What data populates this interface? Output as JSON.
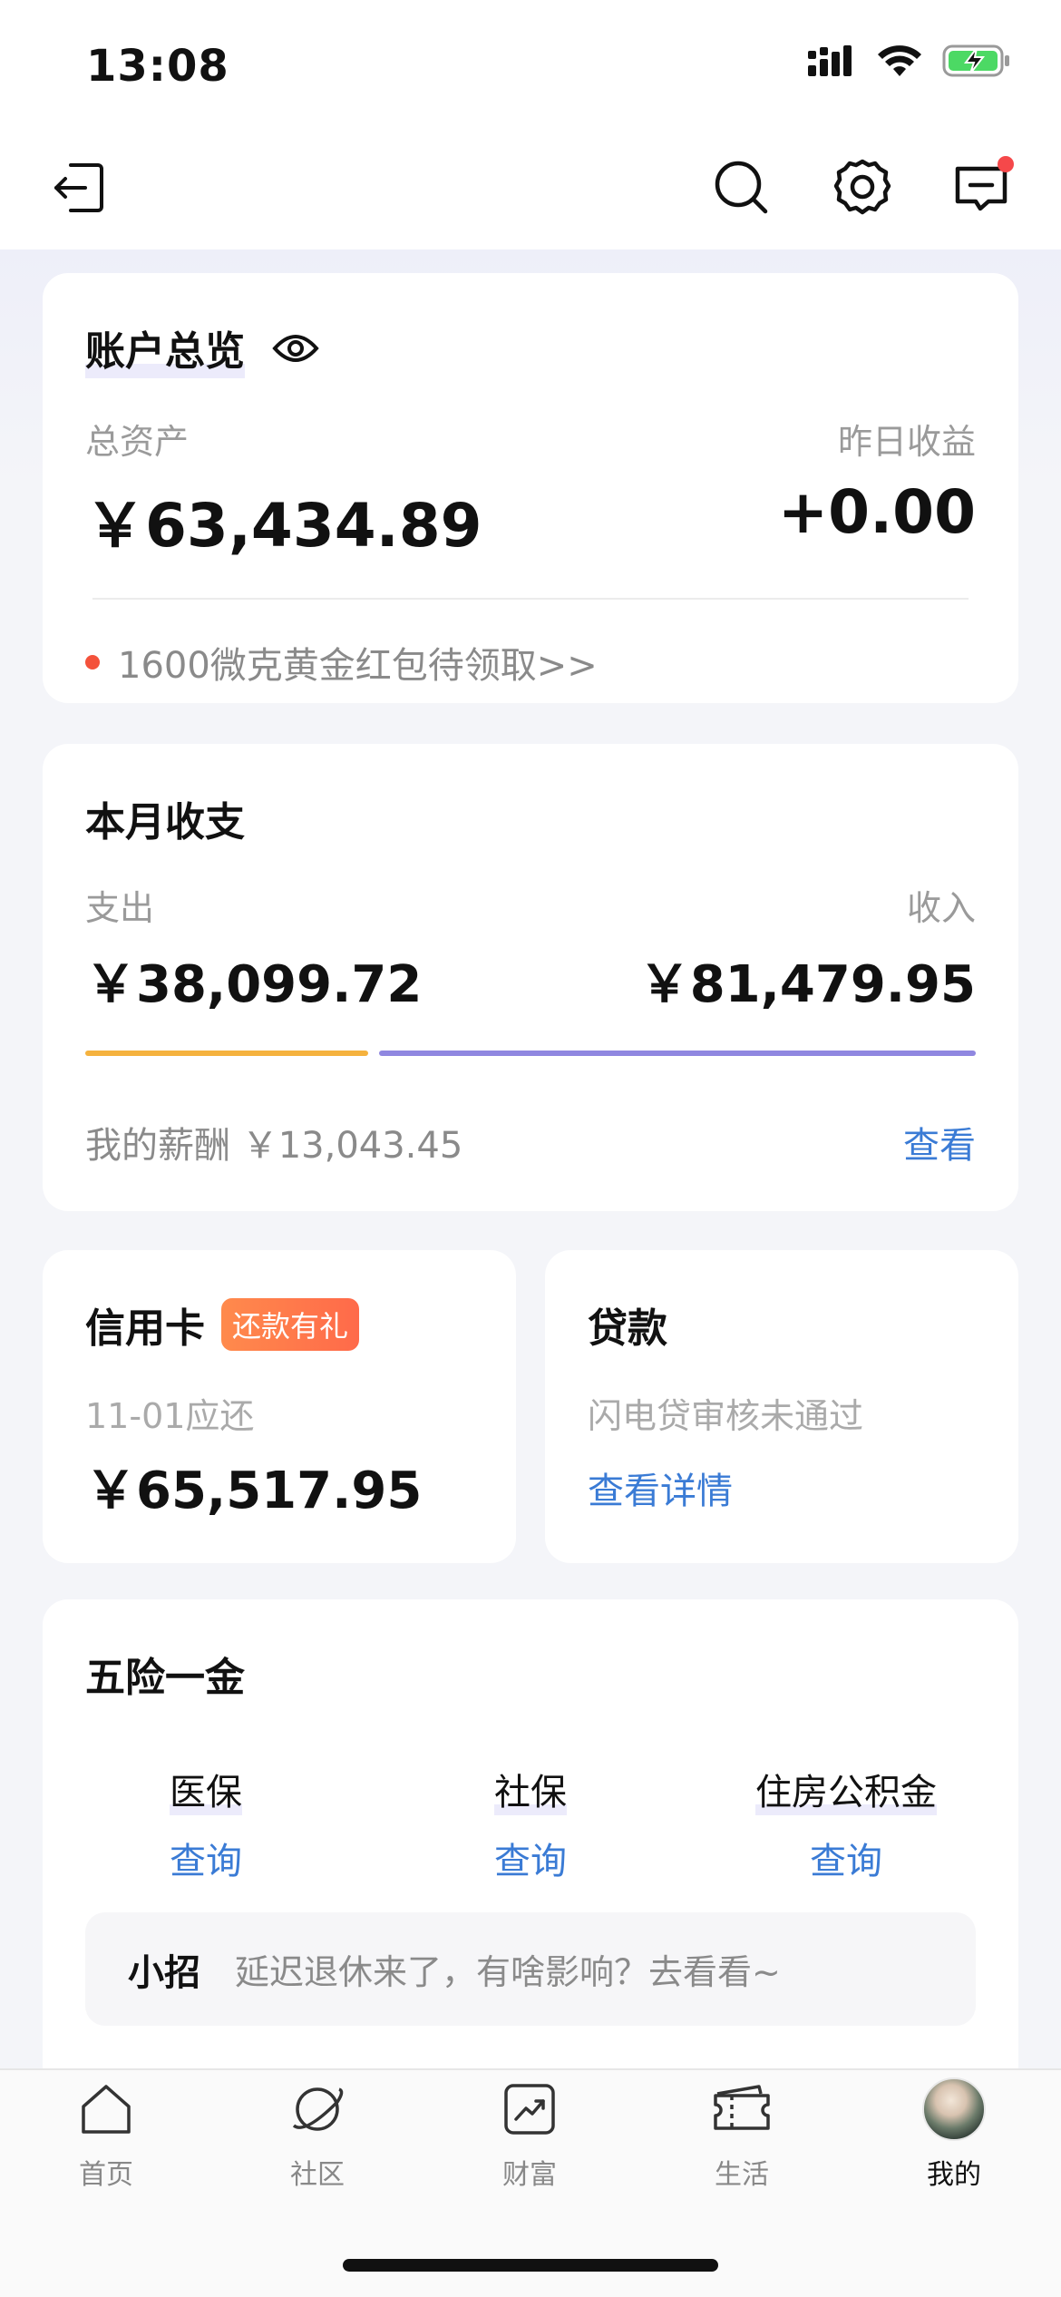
{
  "status_bar": {
    "time": "13:08"
  },
  "account_overview": {
    "title": "账户总览",
    "total_assets_label": "总资产",
    "total_assets_value": "￥63,434.89",
    "yesterday_label": "昨日收益",
    "yesterday_value": "+0.00",
    "promo_text": "1600微克黄金红包待领取>>"
  },
  "monthly": {
    "title": "本月收支",
    "expense_label": "支出",
    "expense_value": "￥38,099.72",
    "income_label": "收入",
    "income_value": "￥81,479.95",
    "expense_share": 0.318,
    "salary_text": "我的薪酬 ￥13,043.45",
    "view_link": "查看",
    "colors": {
      "expense": "#f5b23e",
      "income": "#8f87e0"
    }
  },
  "credit_card": {
    "title": "信用卡",
    "badge": "还款有礼",
    "due_label": "11-01应还",
    "due_amount": "￥65,517.95"
  },
  "loan": {
    "title": "贷款",
    "status": "闪电贷审核未通过",
    "link": "查看详情"
  },
  "insurance": {
    "title": "五险一金",
    "items": [
      {
        "label": "医保",
        "action": "查询"
      },
      {
        "label": "社保",
        "action": "查询"
      },
      {
        "label": "住房公积金",
        "action": "查询"
      }
    ],
    "tip_label": "小招",
    "tip_text": "延迟退休来了，有啥影响？去看看~"
  },
  "tabbar": {
    "items": [
      {
        "label": "首页",
        "icon": "home-icon"
      },
      {
        "label": "社区",
        "icon": "planet-icon"
      },
      {
        "label": "财富",
        "icon": "chart-icon"
      },
      {
        "label": "生活",
        "icon": "ticket-icon"
      },
      {
        "label": "我的",
        "icon": "avatar"
      }
    ]
  }
}
